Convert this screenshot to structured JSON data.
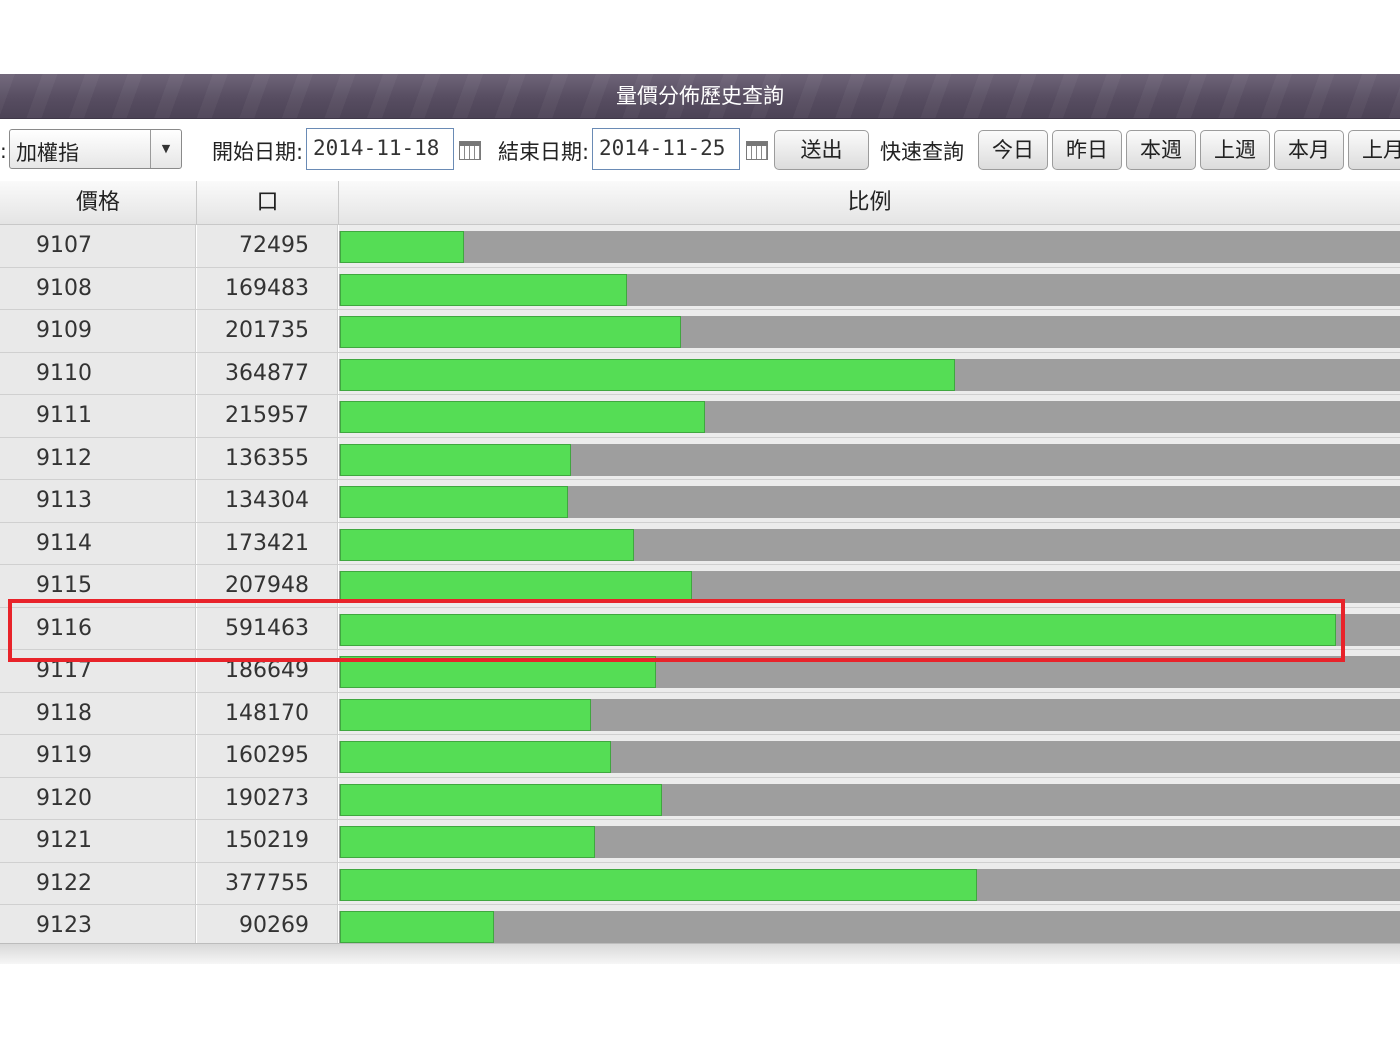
{
  "title": "量價分佈歷史查詢",
  "toolbar": {
    "colon": ":",
    "index_select": "加權指",
    "dropdown_icon": "▼",
    "start_label": "開始日期:",
    "start_date": "2014-11-18",
    "end_label": "結束日期:",
    "end_date": "2014-11-25",
    "submit_label": "送出",
    "quick_label": "快速查詢",
    "quick_buttons": [
      "今日",
      "昨日",
      "本週",
      "上週",
      "本月",
      "上月"
    ]
  },
  "table": {
    "headers": [
      "價格",
      "口",
      "比例"
    ],
    "rows": [
      {
        "price": "9107",
        "volume": "72495"
      },
      {
        "price": "9108",
        "volume": "169483"
      },
      {
        "price": "9109",
        "volume": "201735"
      },
      {
        "price": "9110",
        "volume": "364877"
      },
      {
        "price": "9111",
        "volume": "215957"
      },
      {
        "price": "9112",
        "volume": "136355"
      },
      {
        "price": "9113",
        "volume": "134304"
      },
      {
        "price": "9114",
        "volume": "173421"
      },
      {
        "price": "9115",
        "volume": "207948"
      },
      {
        "price": "9116",
        "volume": "591463"
      },
      {
        "price": "9117",
        "volume": "186649"
      },
      {
        "price": "9118",
        "volume": "148170"
      },
      {
        "price": "9119",
        "volume": "160295"
      },
      {
        "price": "9120",
        "volume": "190273"
      },
      {
        "price": "9121",
        "volume": "150219"
      },
      {
        "price": "9122",
        "volume": "377755"
      },
      {
        "price": "9123",
        "volume": "90269"
      }
    ],
    "bar_scale_max": 630000,
    "highlighted_price": "9116"
  },
  "colors": {
    "bar_fill": "#55dd55",
    "bar_track": "#9e9e9e",
    "highlight": "#e8232a",
    "title_bg": "#574d61"
  },
  "icons": {
    "calendar": "calendar-icon",
    "dropdown": "chevron-down-icon"
  }
}
